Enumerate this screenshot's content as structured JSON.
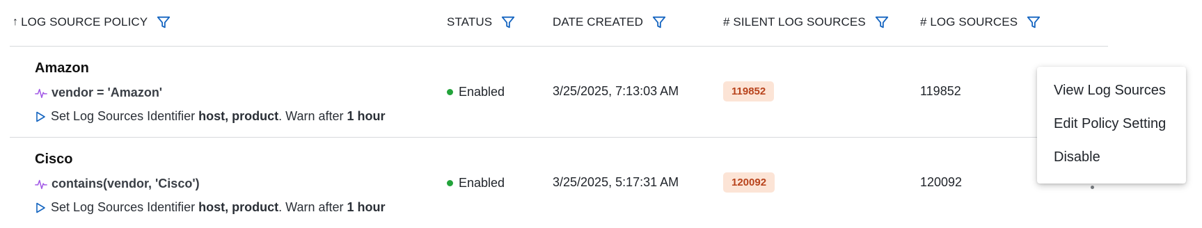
{
  "columns": {
    "policy": "LOG SOURCE POLICY",
    "status": "STATUS",
    "date_created": "DATE CREATED",
    "silent": "# SILENT LOG SOURCES",
    "sources": "# LOG SOURCES"
  },
  "sort_indicator": "↑",
  "icons": {
    "sort": "arrow-up-icon",
    "filter": "funnel-icon",
    "condition": "pulse-icon",
    "expand": "play-triangle-icon",
    "actions": "kebab-icon"
  },
  "rows": [
    {
      "name": "Amazon",
      "condition": "vendor = 'Amazon'",
      "desc_prefix": "Set Log Sources Identifier ",
      "desc_identifiers": "host, product",
      "desc_mid": ". Warn after ",
      "desc_interval": "1 hour",
      "status": "Enabled",
      "date_created": "3/25/2025, 7:13:03 AM",
      "silent_count": "119852",
      "source_count": "119852"
    },
    {
      "name": "Cisco",
      "condition": "contains(vendor, 'Cisco')",
      "desc_prefix": "Set Log Sources Identifier ",
      "desc_identifiers": "host, product",
      "desc_mid": ". Warn after ",
      "desc_interval": "1 hour",
      "status": "Enabled",
      "date_created": "3/25/2025, 5:17:31 AM",
      "silent_count": "120092",
      "source_count": "120092"
    }
  ],
  "context_menu": {
    "items": [
      "View Log Sources",
      "Edit Policy Setting",
      "Disable"
    ]
  },
  "colors": {
    "filter_icon": "#1565c0",
    "pulse_icon": "#a259e6",
    "play_icon": "#1565c0",
    "status_enabled": "#22a33a",
    "badge_bg": "#fce4d6",
    "badge_text": "#b8431c",
    "divider": "#d7d9dc"
  }
}
